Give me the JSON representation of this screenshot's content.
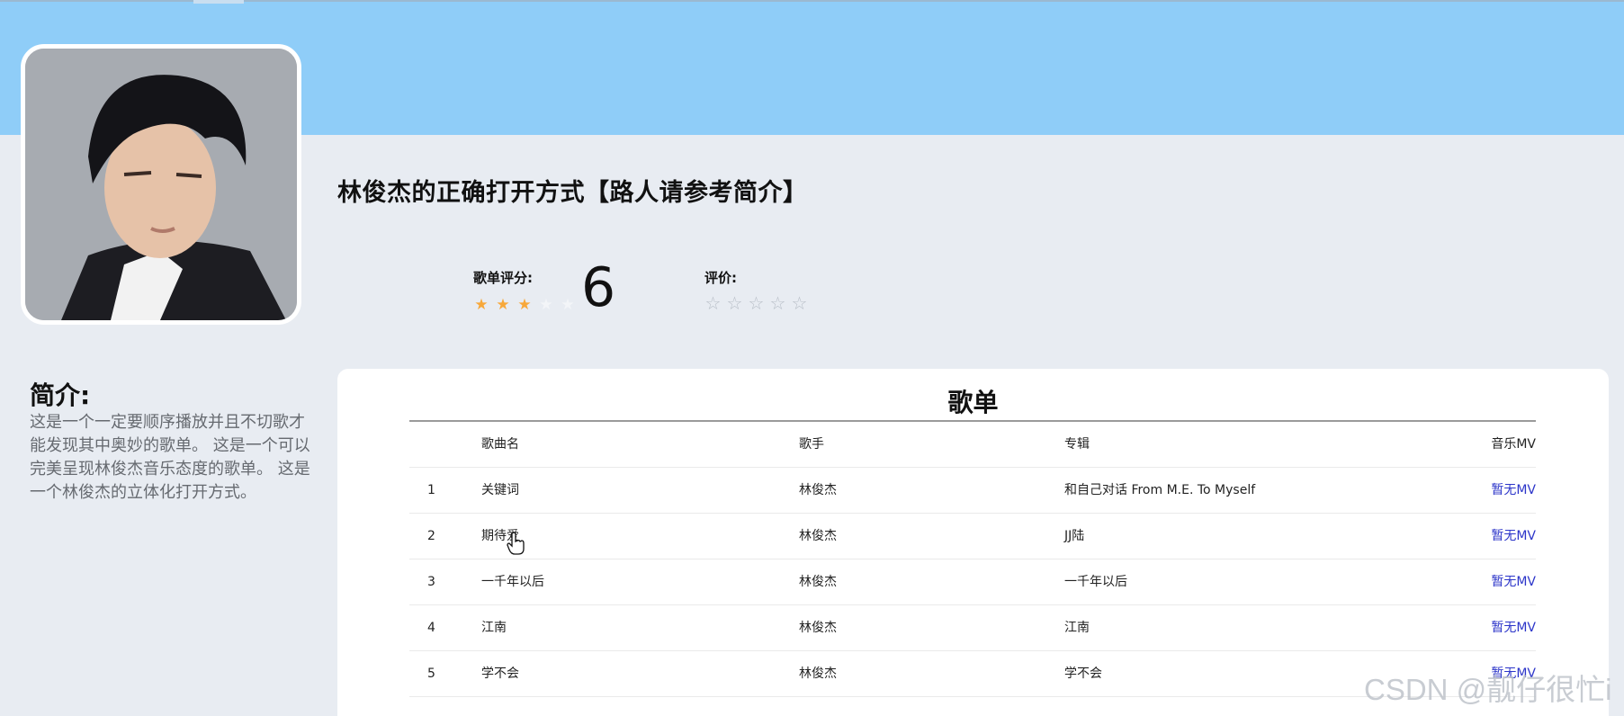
{
  "playlist": {
    "title": "林俊杰的正确打开方式【路人请参考简介】",
    "rating_label": "歌单评分:",
    "score": "6",
    "score_stars": 3,
    "score_stars_total": 5,
    "review_label": "评价:",
    "review_stars_total": 5,
    "avatar_icon": "portrait-icon"
  },
  "intro": {
    "heading": "简介:",
    "text": "这是一个一定要顺序播放并且不切歌才能发现其中奥妙的歌单。 这是一个可以完美呈现林俊杰音乐态度的歌单。 这是一个林俊杰的立体化打开方式。"
  },
  "songs": {
    "title": "歌单",
    "columns": [
      "",
      "歌曲名",
      "歌手",
      "专辑",
      "音乐MV"
    ],
    "rows": [
      {
        "index": "1",
        "name": "关键词",
        "singer": "林俊杰",
        "album": "和自己对话 From M.E. To Myself",
        "mv": "暂无MV"
      },
      {
        "index": "2",
        "name": "期待爱",
        "singer": "林俊杰",
        "album": "JJ陆",
        "mv": "暂无MV"
      },
      {
        "index": "3",
        "name": "一千年以后",
        "singer": "林俊杰",
        "album": "一千年以后",
        "mv": "暂无MV"
      },
      {
        "index": "4",
        "name": "江南",
        "singer": "林俊杰",
        "album": "江南",
        "mv": "暂无MV"
      },
      {
        "index": "5",
        "name": "学不会",
        "singer": "林俊杰",
        "album": "学不会",
        "mv": "暂无MV"
      }
    ]
  },
  "colors": {
    "banner": "#8fcdf8",
    "background": "#e8ecf2",
    "star_active": "#f7a83a",
    "mv_link": "#2c35c9"
  },
  "watermark": "CSDN @靓仔很忙i"
}
